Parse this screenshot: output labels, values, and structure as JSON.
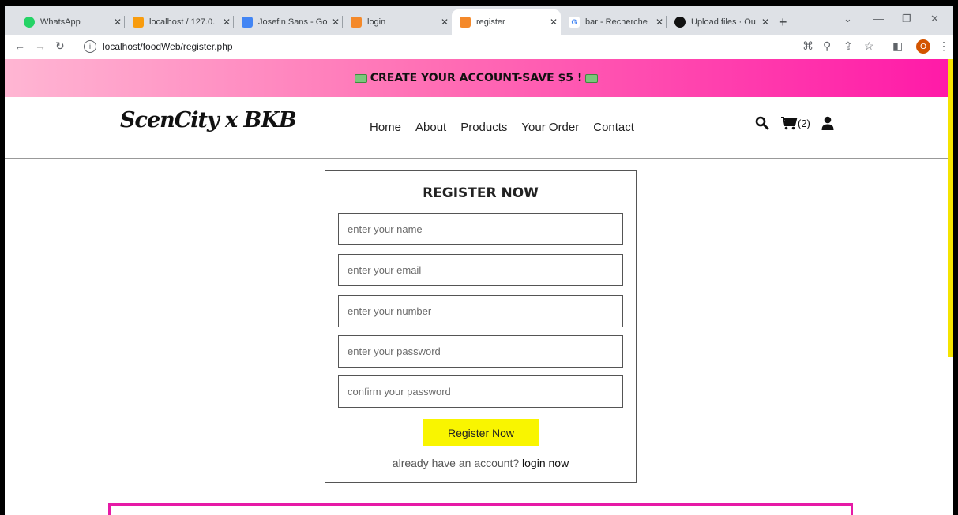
{
  "browser": {
    "tabs": [
      {
        "title": "WhatsApp",
        "fav_color": "#25d366",
        "fav_icon": "whatsapp-icon"
      },
      {
        "title": "localhost / 127.0.",
        "fav_color": "#f89c0e",
        "fav_icon": "phpmyadmin-icon"
      },
      {
        "title": "Josefin Sans - Go",
        "fav_color": "#4285f4",
        "fav_icon": "google-fonts-icon"
      },
      {
        "title": "login",
        "fav_color": "#f4892a",
        "fav_icon": "xampp-icon"
      },
      {
        "title": "register",
        "fav_color": "#f4892a",
        "fav_icon": "xampp-icon"
      },
      {
        "title": "bar - Recherche",
        "fav_color": "#4285f4",
        "fav_icon": "google-icon"
      },
      {
        "title": "Upload files · Ou",
        "fav_color": "#111111",
        "fav_icon": "github-icon"
      }
    ],
    "url": "localhost/foodWeb/register.php",
    "profile_initial": "O"
  },
  "promo": {
    "text": "CREATE YOUR ACCOUNT-SAVE $5 !"
  },
  "header": {
    "logo": "ScenCity x BKB",
    "nav": [
      "Home",
      "About",
      "Products",
      "Your Order",
      "Contact"
    ],
    "cart_count": "(2)"
  },
  "form": {
    "title": "REGISTER NOW",
    "placeholders": {
      "name": "enter your name",
      "email": "enter your email",
      "number": "enter your number",
      "password": "enter your password",
      "confirm": "confirm your password"
    },
    "button": "Register Now",
    "login_prompt": "already have an account?",
    "login_link": "login now"
  },
  "colors": {
    "accent_yellow": "#f9f500",
    "brand_pink": "#ff1aa8"
  }
}
